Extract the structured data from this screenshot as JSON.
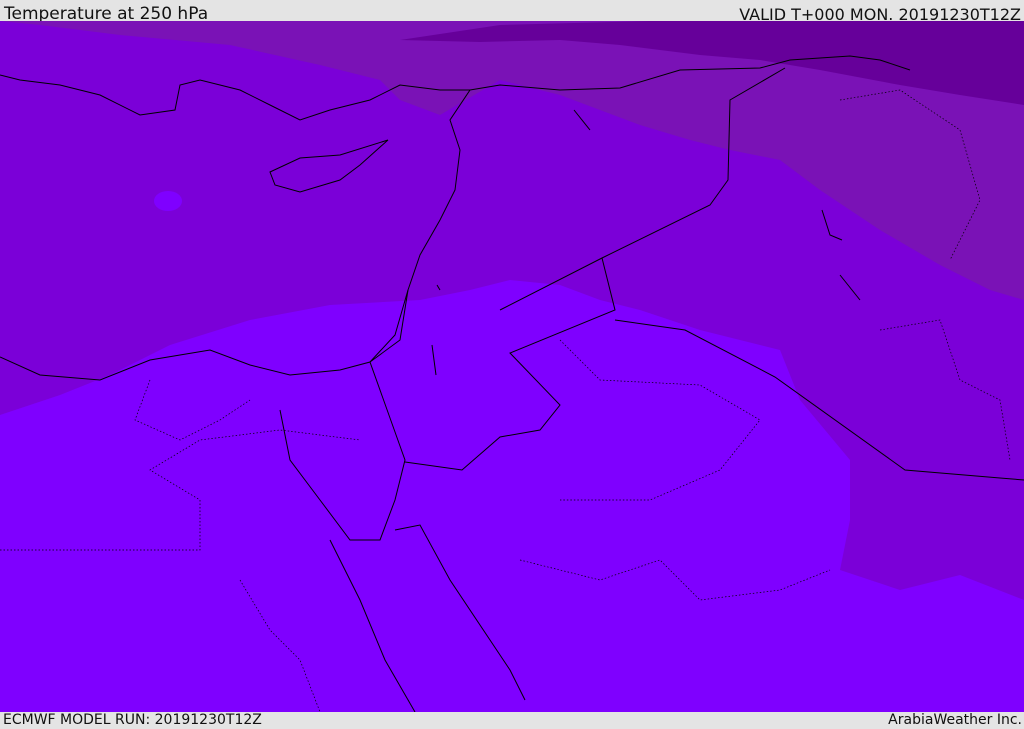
{
  "header": {
    "title": "Temperature at 250 hPa",
    "valid": "VALID T+000 MON. 20191230T12Z"
  },
  "footer": {
    "model_run": "ECMWF MODEL RUN: 20191230T12Z",
    "credit": "ArabiaWeather Inc."
  },
  "colors": {
    "warmest": "#7f00ff",
    "warm": "#7b00d8",
    "cool": "#7a12b6",
    "coolest": "#66009a",
    "coast": "#000000",
    "background": "#e4e4e4"
  }
}
